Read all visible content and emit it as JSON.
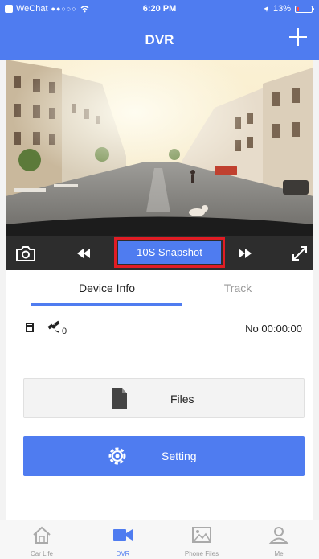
{
  "status_bar": {
    "carrier": "WeChat",
    "signal_dots": "●●○○○",
    "time": "6:20 PM",
    "battery_percent": "13%"
  },
  "nav": {
    "title": "DVR",
    "add_icon": "plus-icon"
  },
  "toolbar": {
    "camera_icon": "camera-icon",
    "rewind_icon": "rewind-icon",
    "snapshot_label": "10S Snapshot",
    "forward_icon": "fast-forward-icon",
    "fullscreen_icon": "expand-icon"
  },
  "tabs": [
    {
      "label": "Device Info",
      "active": true
    },
    {
      "label": "Track",
      "active": false
    }
  ],
  "device_info": {
    "gps_count": "0",
    "record_time": "No 00:00:00"
  },
  "buttons": {
    "files_label": "Files",
    "setting_label": "Setting"
  },
  "tabbar": [
    {
      "label": "Car Life",
      "icon": "home-icon",
      "active": false
    },
    {
      "label": "DVR",
      "icon": "video-camera-icon",
      "active": true
    },
    {
      "label": "Phone Files",
      "icon": "image-icon",
      "active": false
    },
    {
      "label": "Me",
      "icon": "person-icon",
      "active": false
    }
  ],
  "colors": {
    "accent": "#4f7cf0",
    "highlight_border": "#e11c24",
    "toolbar_bg": "#2d2d2d"
  }
}
